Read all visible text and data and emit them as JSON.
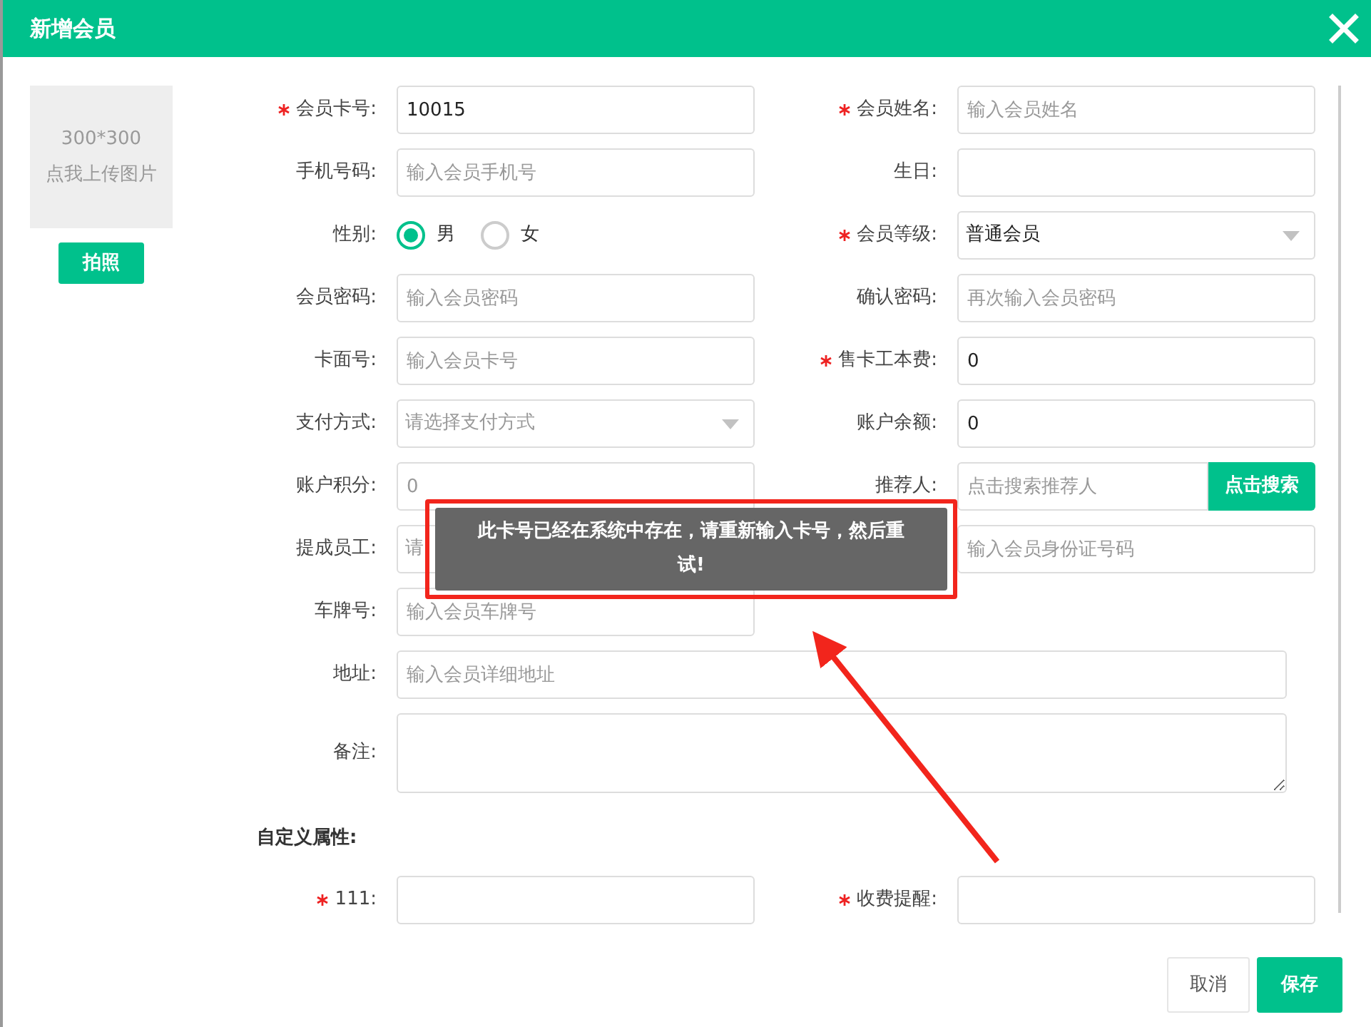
{
  "dialog": {
    "title": "新增会员"
  },
  "photo": {
    "size_hint": "300*300",
    "caption": "点我上传图片",
    "button": "拍照"
  },
  "fields": [
    {
      "label": "会员卡号:",
      "required": true,
      "kind": "text",
      "value": "10015"
    },
    {
      "label": "会员姓名:",
      "required": true,
      "kind": "text",
      "placeholder": "输入会员姓名"
    },
    {
      "label": "手机号码:",
      "kind": "text",
      "placeholder": "输入会员手机号"
    },
    {
      "label": "生日:",
      "kind": "text"
    },
    {
      "label": "性别:",
      "kind": "radio",
      "options": [
        {
          "label": "男",
          "selected": true
        },
        {
          "label": "女",
          "selected": false
        }
      ]
    },
    {
      "label": "会员等级:",
      "required": true,
      "kind": "select",
      "value": "普通会员"
    },
    {
      "label": "会员密码:",
      "kind": "text",
      "placeholder": "输入会员密码"
    },
    {
      "label": "确认密码:",
      "kind": "text",
      "placeholder": "再次输入会员密码"
    },
    {
      "label": "卡面号:",
      "kind": "text",
      "placeholder": "输入会员卡号"
    },
    {
      "label": "售卡工本费:",
      "required": true,
      "kind": "text",
      "value": "0"
    },
    {
      "label": "支付方式:",
      "kind": "select",
      "placeholder": "请选择支付方式"
    },
    {
      "label": "账户余额:",
      "kind": "text",
      "value": "0"
    },
    {
      "label": "账户积分:",
      "kind": "text",
      "placeholder": "0"
    },
    {
      "label": "推荐人:",
      "kind": "search",
      "placeholder": "点击搜索推荐人",
      "button": "点击搜索"
    },
    {
      "label": "提成员工:",
      "kind": "select",
      "placeholder": "请"
    },
    {
      "kind": "text",
      "placeholder": "输入会员身份证号码"
    },
    {
      "label": "车牌号:",
      "kind": "text",
      "placeholder": "输入会员车牌号"
    },
    {
      "label": "地址:",
      "kind": "text",
      "wide": true,
      "placeholder": "输入会员详细地址"
    },
    {
      "label": "备注:",
      "kind": "textarea",
      "wide": true
    }
  ],
  "custom_section": {
    "title": "自定义属性:",
    "fields": [
      {
        "label": "111:",
        "required": true,
        "kind": "text"
      },
      {
        "label": "收费提醒:",
        "required": true,
        "kind": "text"
      }
    ]
  },
  "toast": {
    "message": "此卡号已经在系统中存在，请重新输入卡号，然后重试!"
  },
  "buttons": [
    {
      "label": "取消",
      "kind": "secondary"
    },
    {
      "label": "保存",
      "kind": "primary"
    }
  ]
}
